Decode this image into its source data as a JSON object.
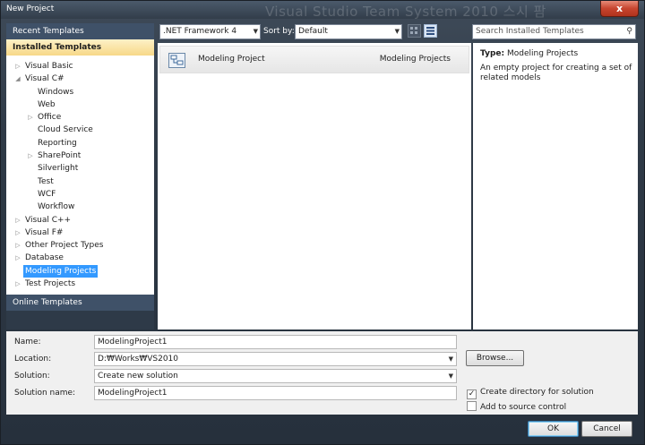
{
  "window": {
    "title": "New Project",
    "watermark": "Visual Studio Team System 2010 스시 팜",
    "close_glyph": "x"
  },
  "left": {
    "recent": "Recent Templates",
    "installed": "Installed Templates",
    "online": "Online Templates",
    "tree": [
      {
        "label": "Visual Basic",
        "level": 0,
        "arrow": "▷"
      },
      {
        "label": "Visual C#",
        "level": 0,
        "arrow": "◢"
      },
      {
        "label": "Windows",
        "level": 1,
        "arrow": ""
      },
      {
        "label": "Web",
        "level": 1,
        "arrow": ""
      },
      {
        "label": "Office",
        "level": 1,
        "arrow": "▷"
      },
      {
        "label": "Cloud Service",
        "level": 1,
        "arrow": ""
      },
      {
        "label": "Reporting",
        "level": 1,
        "arrow": ""
      },
      {
        "label": "SharePoint",
        "level": 1,
        "arrow": "▷"
      },
      {
        "label": "Silverlight",
        "level": 1,
        "arrow": ""
      },
      {
        "label": "Test",
        "level": 1,
        "arrow": ""
      },
      {
        "label": "WCF",
        "level": 1,
        "arrow": ""
      },
      {
        "label": "Workflow",
        "level": 1,
        "arrow": ""
      },
      {
        "label": "Visual C++",
        "level": 0,
        "arrow": "▷"
      },
      {
        "label": "Visual F#",
        "level": 0,
        "arrow": "▷"
      },
      {
        "label": "Other Project Types",
        "level": 0,
        "arrow": "▷"
      },
      {
        "label": "Database",
        "level": 0,
        "arrow": "▷"
      },
      {
        "label": "Modeling Projects",
        "level": 0,
        "arrow": "",
        "selected": true
      },
      {
        "label": "Test Projects",
        "level": 0,
        "arrow": "▷"
      }
    ]
  },
  "toolbar": {
    "framework": ".NET Framework 4",
    "sort_label": "Sort by:",
    "sort_value": "Default",
    "search_placeholder": "Search Installed Templates"
  },
  "templates": [
    {
      "name": "Modeling Project",
      "type": "Modeling Projects"
    }
  ],
  "description": {
    "type_label": "Type:",
    "type_value": "Modeling Projects",
    "text": "An empty project for creating a set of related models"
  },
  "form": {
    "name_label": "Name:",
    "name_value": "ModelingProject1",
    "location_label": "Location:",
    "location_value": "D:₩Works₩VS2010",
    "solution_label": "Solution:",
    "solution_value": "Create new solution",
    "solution_name_label": "Solution name:",
    "solution_name_value": "ModelingProject1",
    "browse": "Browse...",
    "create_dir": "Create directory for solution",
    "create_dir_checked": true,
    "source_control": "Add to source control",
    "source_control_checked": false
  },
  "buttons": {
    "ok": "OK",
    "cancel": "Cancel"
  }
}
